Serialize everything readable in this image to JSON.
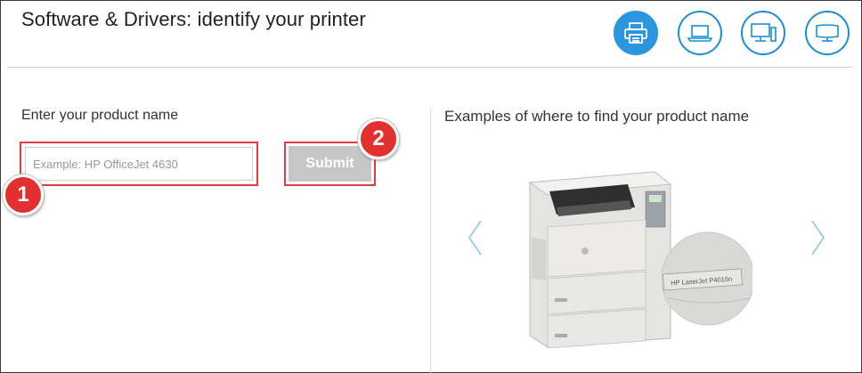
{
  "header": {
    "title": "Software & Drivers: identify your printer",
    "device_types": [
      {
        "name": "printer",
        "active": true
      },
      {
        "name": "laptop",
        "active": false
      },
      {
        "name": "desktop",
        "active": false
      },
      {
        "name": "monitor",
        "active": false
      }
    ]
  },
  "form": {
    "label": "Enter your product name",
    "placeholder": "Example: HP OfficeJet 4630",
    "value": "",
    "submit_label": "Submit"
  },
  "annotations": {
    "step1": "1",
    "step2": "2"
  },
  "examples": {
    "title": "Examples of where to find your product name",
    "image_label": "HP LaserJet P4015n"
  },
  "colors": {
    "accent": "#2b96de",
    "highlight": "#e23d3d",
    "submit_bg": "#c6c6c6"
  }
}
